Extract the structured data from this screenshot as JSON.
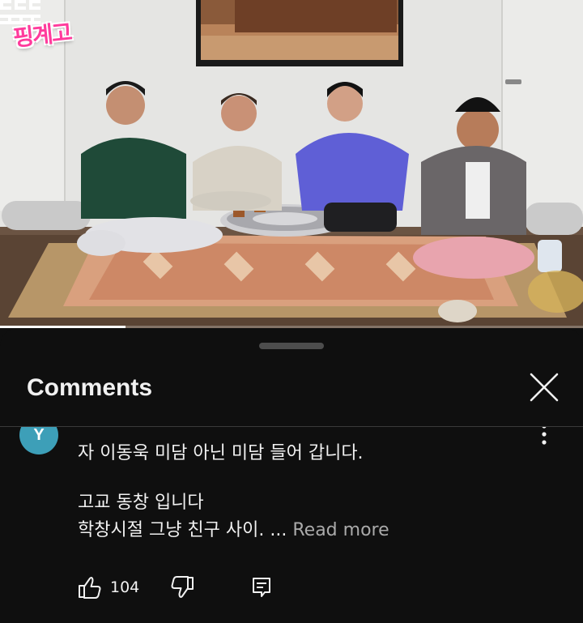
{
  "video": {
    "progress_fraction": 0.215,
    "show_logo_text": "핑계고",
    "overlay_colors": {
      "show_logo": "#ff3b9c",
      "progress": "#ffffff"
    }
  },
  "comments_panel": {
    "title": "Comments",
    "close_icon": "close-icon",
    "comment": {
      "avatar_letter": "Y",
      "avatar_color": "#3d9fb8",
      "author_line": "· · · · ·",
      "lines": [
        "자 이동욱 미담 아닌 미담 들어 갑니다.",
        "고교 동창 입니다",
        "학창시절 그냥 친구 사이. ..."
      ],
      "read_more": "Read more",
      "like_count": "104",
      "icons": {
        "like": "thumb-up-icon",
        "dislike": "thumb-down-icon",
        "reply": "reply-icon",
        "more": "more-vert-icon"
      }
    }
  }
}
